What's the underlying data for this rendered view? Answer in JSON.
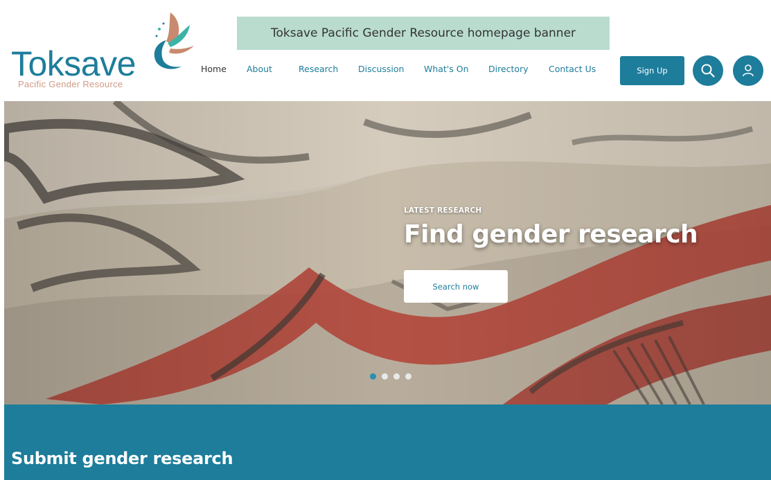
{
  "caption": "Toksave Pacific Gender Resource homepage banner",
  "logo": {
    "wordmark": "Toksave",
    "tagline": "Pacific Gender Resource"
  },
  "nav": {
    "items": [
      "Home",
      "About",
      "Research",
      "Discussion",
      "What's On",
      "Directory",
      "Contact Us"
    ],
    "active": "Home"
  },
  "header": {
    "signup_label": "Sign Up",
    "search_icon": "search-icon",
    "user_icon": "user-icon"
  },
  "hero": {
    "eyebrow": "LATEST RESEARCH",
    "title": "Find gender research",
    "button_label": "Search now",
    "slide_count": 4,
    "active_slide": 1
  },
  "section": {
    "title": "Submit gender research"
  },
  "colors": {
    "brand_teal": "#1d7d9b",
    "tagline_rose": "#cf9a86",
    "caption_bg": "#b9dccf",
    "tapa_red": "#b4473c"
  }
}
